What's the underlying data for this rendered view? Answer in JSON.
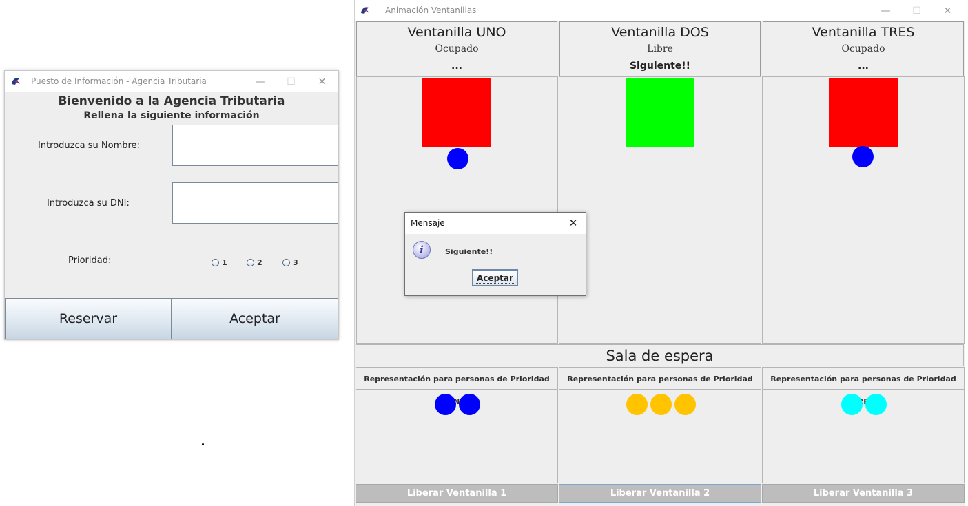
{
  "window1": {
    "title": "Puesto de Información - Agencia Tributaria",
    "heading": "Bienvenido a la Agencia Tributaria",
    "subheading": "Rellena la siguiente información",
    "name_label": "Introduzca su Nombre:",
    "name_value": "",
    "dni_label": "Introduzca su DNI:",
    "dni_value": "",
    "priority_label": "Prioridad:",
    "priority_options": [
      "1",
      "2",
      "3"
    ],
    "reservar_label": "Reservar",
    "aceptar_label": "Aceptar"
  },
  "window2": {
    "title": "Animación Ventanillas",
    "ventanillas": [
      {
        "name": "Ventanilla UNO",
        "state": "Ocupado",
        "next": "...",
        "color": "#ff0000",
        "has_person": true
      },
      {
        "name": "Ventanilla DOS",
        "state": "Libre",
        "next": "Siguiente!!",
        "color": "#00ff00",
        "has_person": false
      },
      {
        "name": "Ventanilla TRES",
        "state": "Ocupado",
        "next": "...",
        "color": "#ff0000",
        "has_person": true
      }
    ],
    "sala_title": "Sala de espera",
    "priority_groups": [
      {
        "label": "Representación para personas de Prioridad UNO",
        "count": 2,
        "color": "#0000ff"
      },
      {
        "label": "Representación para personas de Prioridad DOS",
        "count": 3,
        "color": "#ffc300"
      },
      {
        "label": "Representación para personas de Prioridad TRES",
        "count": 2,
        "color": "#00ffff"
      }
    ],
    "release_buttons": [
      "Liberar Ventanilla 1",
      "Liberar Ventanilla 2",
      "Liberar Ventanilla 3"
    ],
    "person_color": "#0000ff"
  },
  "dialog": {
    "title": "Mensaje",
    "message": "Siguiente!!",
    "button": "Aceptar",
    "icon": "info-icon"
  }
}
